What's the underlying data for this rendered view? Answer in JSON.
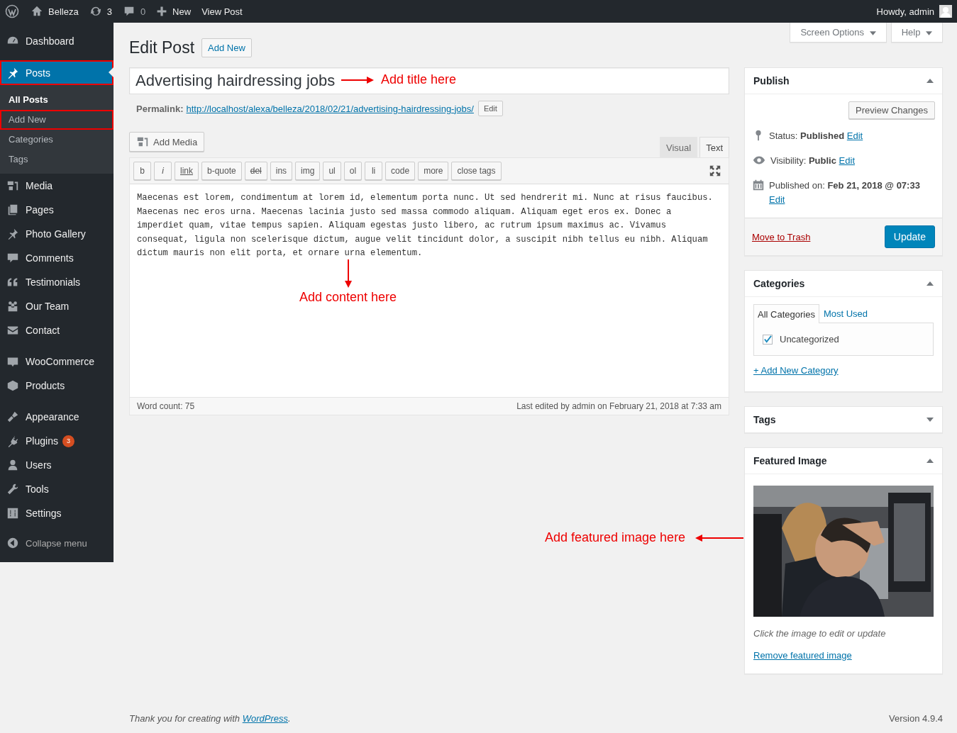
{
  "admin_bar": {
    "site": "Belleza",
    "updates": "3",
    "comments": "0",
    "new": "New",
    "view": "View Post",
    "howdy": "Howdy, admin"
  },
  "sidebar": {
    "groups": [
      {
        "items": [
          {
            "label": "Dashboard",
            "selected": false,
            "outlined": false
          }
        ]
      },
      {
        "items": [
          {
            "label": "Posts",
            "selected": true,
            "outlined": true,
            "children": [
              {
                "label": "All Posts",
                "selected": true,
                "outlined": false
              },
              {
                "label": "Add New",
                "selected": false,
                "outlined": true
              },
              {
                "label": "Categories",
                "selected": false,
                "outlined": false
              },
              {
                "label": "Tags",
                "selected": false,
                "outlined": false
              }
            ]
          },
          {
            "label": "Media",
            "selected": false,
            "outlined": false
          },
          {
            "label": "Pages",
            "selected": false,
            "outlined": false
          },
          {
            "label": "Photo Gallery",
            "selected": false,
            "outlined": false
          },
          {
            "label": "Comments",
            "selected": false,
            "outlined": false
          },
          {
            "label": "Testimonials",
            "selected": false,
            "outlined": false
          },
          {
            "label": "Our Team",
            "selected": false,
            "outlined": false
          },
          {
            "label": "Contact",
            "selected": false,
            "outlined": false
          }
        ]
      },
      {
        "items": [
          {
            "label": "WooCommerce",
            "selected": false,
            "outlined": false
          },
          {
            "label": "Products",
            "selected": false,
            "outlined": false
          }
        ]
      },
      {
        "items": [
          {
            "label": "Appearance",
            "selected": false,
            "outlined": false
          },
          {
            "label": "Plugins",
            "selected": false,
            "outlined": false,
            "badge": "3"
          },
          {
            "label": "Users",
            "selected": false,
            "outlined": false
          },
          {
            "label": "Tools",
            "selected": false,
            "outlined": false
          },
          {
            "label": "Settings",
            "selected": false,
            "outlined": false
          }
        ]
      }
    ],
    "collapse": "Collapse menu"
  },
  "header": {
    "title": "Edit Post",
    "add_new": "Add New",
    "screen_options": "Screen Options",
    "help": "Help"
  },
  "post_title": "Advertising hairdressing jobs",
  "permalink": {
    "label": "Permalink:",
    "url": "http://localhost/alexa/belleza/2018/02/21/advertising-hairdressing-jobs/",
    "edit": "Edit"
  },
  "editor": {
    "add_media": "Add Media",
    "tabs": [
      {
        "label": "Visual",
        "selected": false
      },
      {
        "label": "Text",
        "selected": true
      }
    ],
    "quicktags": [
      {
        "label": "b",
        "kind": "plain"
      },
      {
        "label": "i",
        "kind": "italic"
      },
      {
        "label": "link",
        "kind": "link"
      },
      {
        "label": "b-quote",
        "kind": "plain"
      },
      {
        "label": "del",
        "kind": "del"
      },
      {
        "label": "ins",
        "kind": "plain"
      },
      {
        "label": "img",
        "kind": "plain"
      },
      {
        "label": "ul",
        "kind": "plain"
      },
      {
        "label": "ol",
        "kind": "plain"
      },
      {
        "label": "li",
        "kind": "plain"
      },
      {
        "label": "code",
        "kind": "plain"
      },
      {
        "label": "more",
        "kind": "plain"
      },
      {
        "label": "close tags",
        "kind": "plain"
      }
    ],
    "content": "Maecenas est lorem, condimentum at lorem id, elementum porta nunc. Ut sed hendrerit mi. Nunc at risus faucibus. Maecenas nec eros urna. Maecenas lacinia justo sed massa commodo aliquam. Aliquam eget eros ex. Donec a imperdiet quam, vitae tempus sapien. Aliquam egestas justo libero, ac rutrum ipsum maximus ac. Vivamus consequat, ligula non scelerisque dictum, augue velit tincidunt dolor, a suscipit nibh tellus eu nibh. Aliquam dictum mauris non elit porta, et ornare urna elementum.",
    "word_count": "Word count: 75",
    "last_edited": "Last edited by admin on February 21, 2018 at 7:33 am"
  },
  "annotations": [
    {
      "kind": "title",
      "text": "Add title here"
    },
    {
      "kind": "content",
      "text": "Add content here"
    },
    {
      "text": "Add featured image here"
    }
  ],
  "publish": {
    "title": "Publish",
    "expanded": true,
    "preview": "Preview Changes",
    "rows": [
      {
        "kind": "status",
        "label": "Status:",
        "value": "Published",
        "edit": "Edit"
      },
      {
        "kind": "visibility",
        "label": "Visibility:",
        "value": "Public",
        "edit": "Edit"
      },
      {
        "kind": "schedule",
        "label": "Published on:",
        "value": "Feb 21, 2018 @ 07:33",
        "edit": "Edit"
      }
    ],
    "trash": "Move to Trash",
    "update": "Update"
  },
  "categories": {
    "title": "Categories",
    "expanded": true,
    "tabs": [
      {
        "label": "All Categories",
        "selected": true
      },
      {
        "label": "Most Used",
        "selected": false
      }
    ],
    "items": [
      {
        "label": "Uncategorized",
        "checked": true
      }
    ],
    "add_new": "+ Add New Category"
  },
  "tags": {
    "title": "Tags",
    "expanded": false
  },
  "featured_image": {
    "title": "Featured Image",
    "expanded": true,
    "hint": "Click the image to edit or update",
    "remove": "Remove featured image"
  },
  "footer": {
    "before": "Thank you for creating with",
    "link": "WordPress",
    "after": ".",
    "version": "Version 4.9.4"
  }
}
